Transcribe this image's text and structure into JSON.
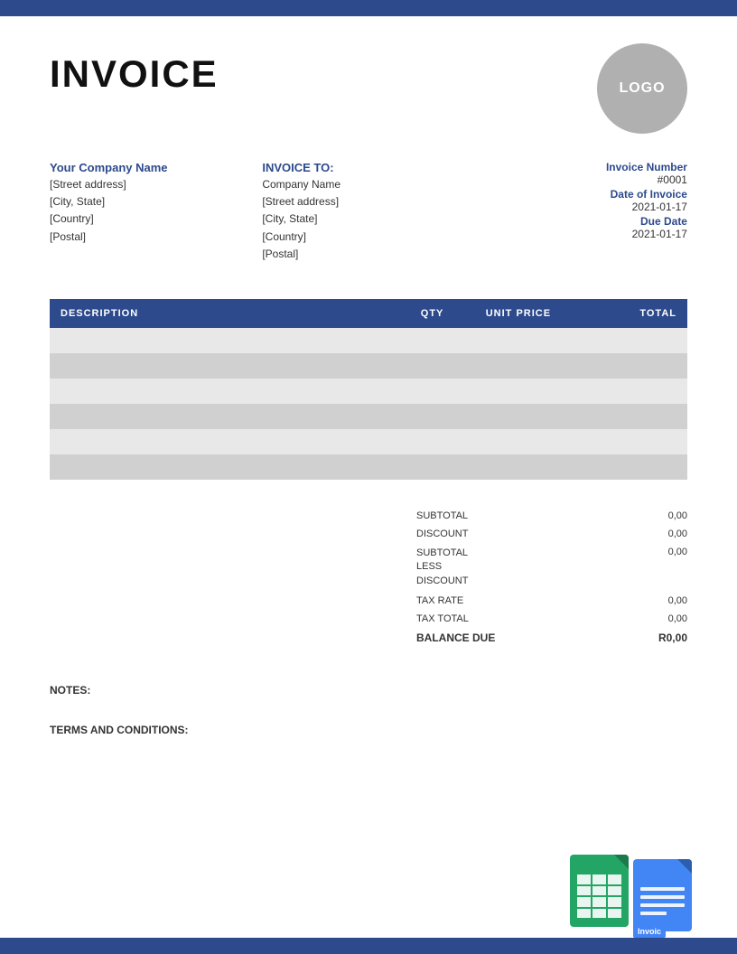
{
  "topBar": {},
  "header": {
    "title": "INVOICE",
    "logo_text": "LOGO"
  },
  "from": {
    "company_name": "Your Company Name",
    "line1": "[Street address]",
    "line2": "[City, State]",
    "line3": "[Country]",
    "line4": "[Postal]"
  },
  "to": {
    "label": "INVOICE TO:",
    "company": "Company Name",
    "line1": "[Street address]",
    "line2": "[City, State]",
    "line3": "[Country]",
    "line4": "[Postal]"
  },
  "meta": {
    "invoice_number_label": "Invoice Number",
    "invoice_number": "#0001",
    "date_of_invoice_label": "Date of Invoice",
    "date_of_invoice": "2021-01-17",
    "due_date_label": "Due Date",
    "due_date": "2021-01-17"
  },
  "table": {
    "columns": [
      "DESCRIPTION",
      "QTY",
      "UNIT PRICE",
      "TOTAL"
    ],
    "rows": [
      {
        "description": "",
        "qty": "",
        "unit_price": "",
        "total": ""
      },
      {
        "description": "",
        "qty": "",
        "unit_price": "",
        "total": ""
      },
      {
        "description": "",
        "qty": "",
        "unit_price": "",
        "total": ""
      },
      {
        "description": "",
        "qty": "",
        "unit_price": "",
        "total": ""
      },
      {
        "description": "",
        "qty": "",
        "unit_price": "",
        "total": ""
      },
      {
        "description": "",
        "qty": "",
        "unit_price": "",
        "total": ""
      }
    ]
  },
  "totals": {
    "subtotal_label": "SUBTOTAL",
    "subtotal_value": "0,00",
    "discount_label": "DISCOUNT",
    "discount_value": "0,00",
    "subtotal_less_label": "SUBTOTAL LESS DISCOUNT",
    "subtotal_less_value": "0,00",
    "tax_rate_label": "TAX RATE",
    "tax_rate_value": "0,00",
    "tax_total_label": "TAX TOTAL",
    "tax_total_value": "0,00",
    "balance_due_label": "BALANCE DUE",
    "balance_due_value": "R0,00"
  },
  "notes": {
    "label": "NOTES:"
  },
  "terms": {
    "label": "TERMS AND CONDITIONS:"
  }
}
